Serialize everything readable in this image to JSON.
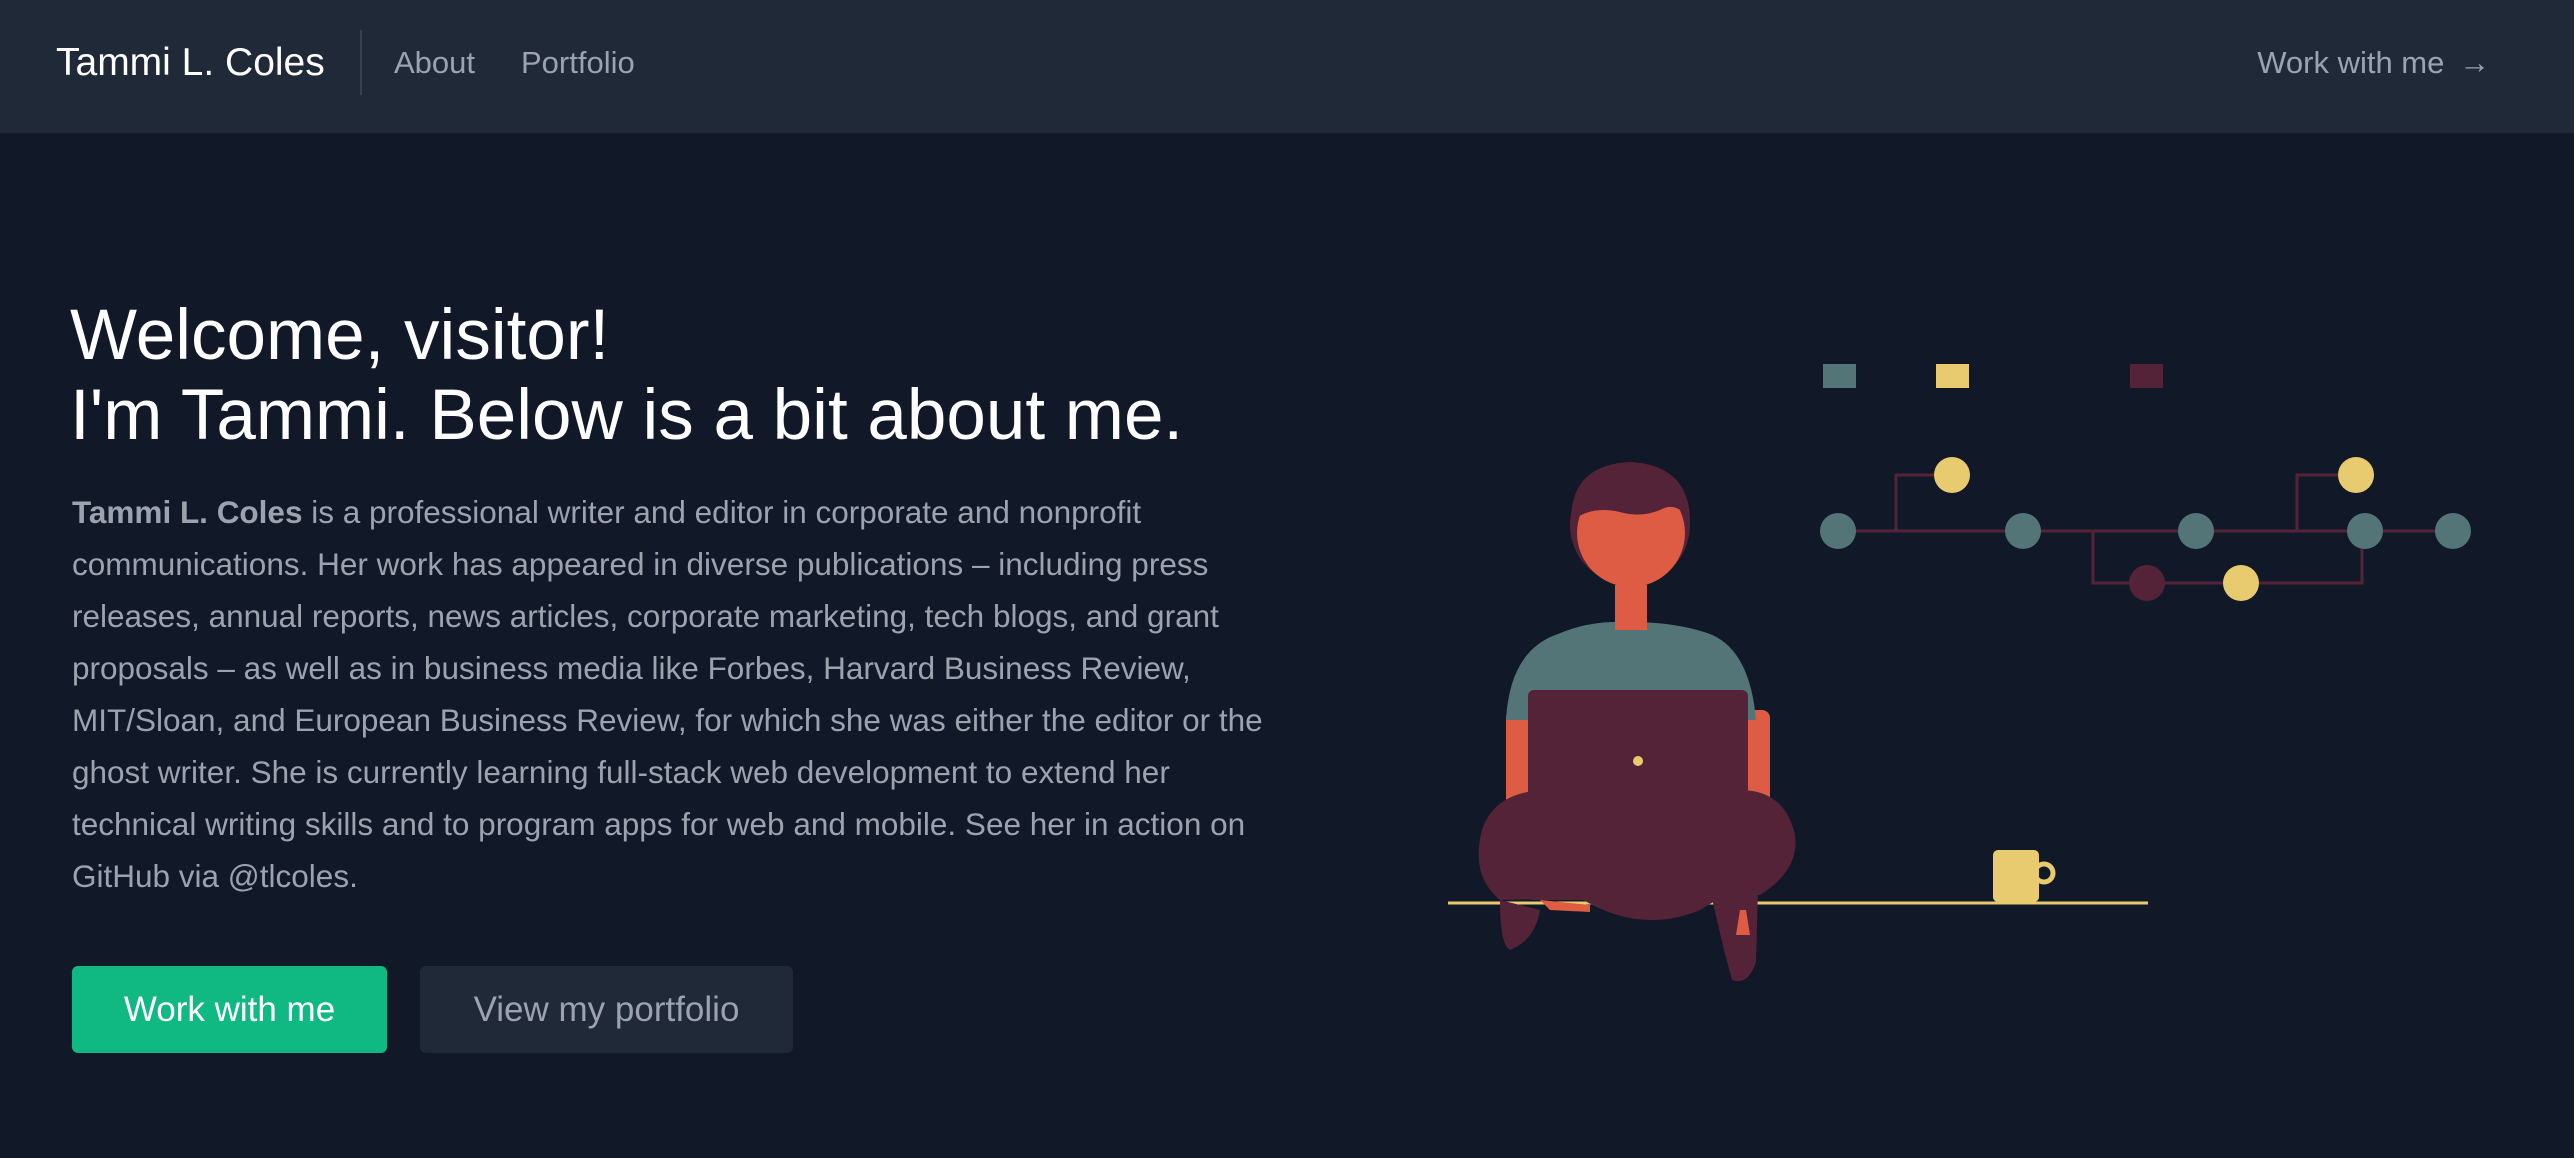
{
  "nav": {
    "brand": "Tammi L. Coles",
    "links": [
      {
        "label": "About"
      },
      {
        "label": "Portfolio"
      }
    ],
    "cta_label": "Work with me",
    "cta_icon": "arrow-right-icon",
    "cta_arrow": "→"
  },
  "hero": {
    "headline_line1": "Welcome, visitor!",
    "headline_line2": "I'm Tammi. Below is a bit about me.",
    "bio_name": "Tammi L. Coles",
    "bio_text": " is a professional writer and editor in corporate and nonprofit communications. Her work has appeared in diverse publications – including press releases, annual reports, news articles, corporate marketing, tech blogs, and grant proposals – as well as in business media like Forbes, Harvard Business Review, MIT/Sloan, and European Business Review, for which she was either the editor or the ghost writer. She is currently learning full-stack web development to extend her technical writing skills and to program apps for web and mobile. See her in action on GitHub via @tlcoles.",
    "primary_button": "Work with me",
    "secondary_button": "View my portfolio"
  },
  "colors": {
    "page_bg": "#111827",
    "navbar_bg": "#1f2937",
    "accent_green": "#10b981",
    "text_muted": "#9ca3af",
    "illustration_teal": "#537578",
    "illustration_yellow": "#e9cb6f",
    "illustration_maroon": "#552337",
    "illustration_orange": "#dd5c43"
  }
}
